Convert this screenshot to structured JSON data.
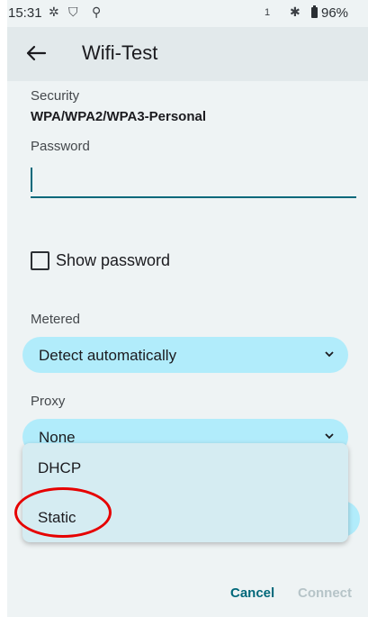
{
  "status_bar": {
    "time": "15:31",
    "sim_slot": "1",
    "battery": "96%",
    "icons": [
      "gear-icon",
      "shield-icon",
      "usb-icon",
      "bluetooth-icon",
      "battery-icon"
    ]
  },
  "app_bar": {
    "title": "Wifi-Test",
    "back_icon": "arrow-left-icon"
  },
  "form": {
    "security_label": "Security",
    "security_value": "WPA/WPA2/WPA3-Personal",
    "password_label": "Password",
    "password_value": "",
    "show_password_label": "Show password",
    "show_password_checked": false,
    "metered_label": "Metered",
    "metered_value": "Detect automatically",
    "proxy_label": "Proxy",
    "proxy_value": "None"
  },
  "popup_menu": {
    "options": [
      "DHCP",
      "Static"
    ],
    "highlighted": "Static"
  },
  "footer": {
    "cancel_label": "Cancel",
    "connect_label": "Connect"
  },
  "colors": {
    "accent": "#00687a",
    "dropdown_bg": "#b1ecfb",
    "annotation_circle": "#e60000"
  }
}
